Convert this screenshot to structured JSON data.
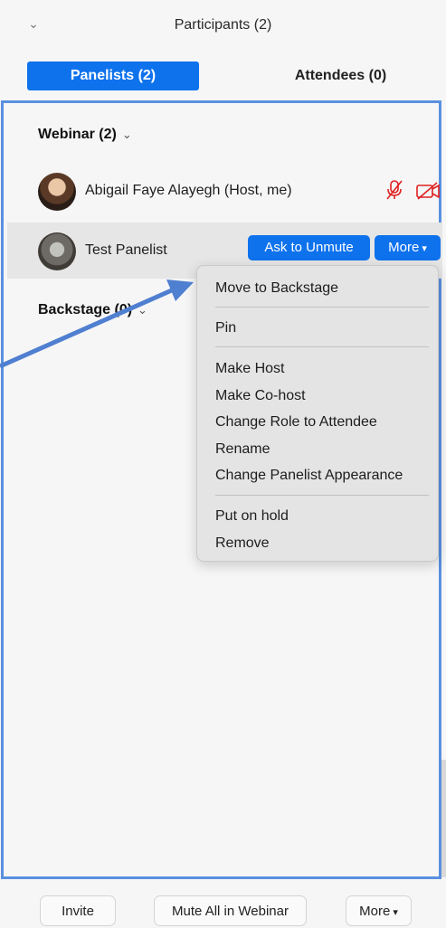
{
  "header": {
    "title": "Participants (2)"
  },
  "tabs": [
    {
      "label": "Panelists (2)",
      "active": true
    },
    {
      "label": "Attendees (0)",
      "active": false
    }
  ],
  "sections": {
    "webinar": {
      "title": "Webinar (2)"
    },
    "backstage": {
      "title": "Backstage (0)"
    }
  },
  "participants": [
    {
      "name": "Abigail Faye Alayegh (Host, me)",
      "mic": "muted",
      "video": "off"
    },
    {
      "name": "Test Panelist"
    }
  ],
  "row_actions": {
    "ask_to_unmute": "Ask to Unmute",
    "more": "More"
  },
  "menu": {
    "groups": [
      [
        "Move to Backstage"
      ],
      [
        "Pin"
      ],
      [
        "Make Host",
        "Make Co-host",
        "Change Role to Attendee",
        "Rename",
        "Change Panelist Appearance"
      ],
      [
        "Put on hold",
        "Remove"
      ]
    ]
  },
  "footer": {
    "invite": "Invite",
    "mute_all": "Mute All in Webinar",
    "more": "More"
  },
  "colors": {
    "accent": "#0e72ed",
    "annotation": "#4f7fd0",
    "mute_red": "#e02020"
  }
}
